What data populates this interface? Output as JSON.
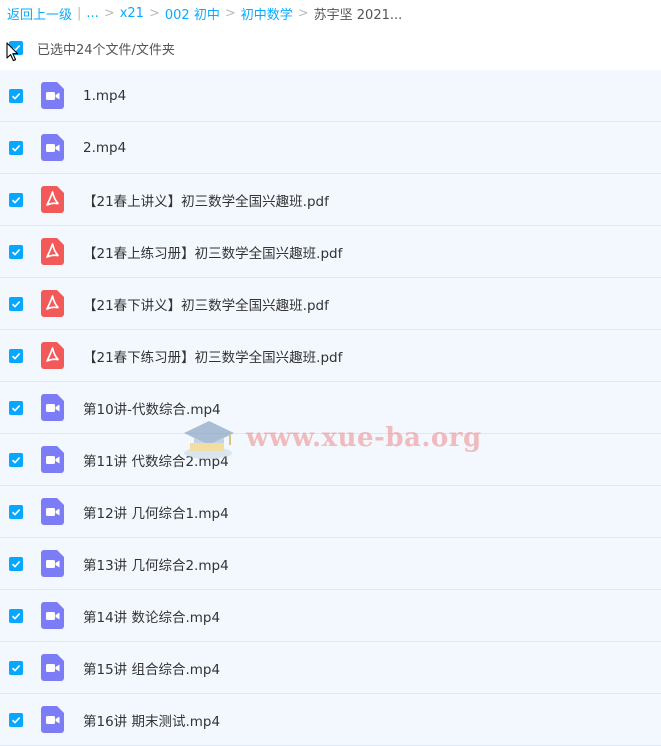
{
  "breadcrumb": {
    "back": "返回上一级",
    "ellipsis": "...",
    "items": [
      "x21",
      "002 初中",
      "初中数学"
    ],
    "current": "苏宇坚 2021..."
  },
  "selection": {
    "text": "已选中24个文件/文件夹"
  },
  "files": [
    {
      "name": "1.mp4",
      "type": "video"
    },
    {
      "name": "2.mp4",
      "type": "video"
    },
    {
      "name": "【21春上讲义】初三数学全国兴趣班.pdf",
      "type": "pdf"
    },
    {
      "name": "【21春上练习册】初三数学全国兴趣班.pdf",
      "type": "pdf"
    },
    {
      "name": "【21春下讲义】初三数学全国兴趣班.pdf",
      "type": "pdf"
    },
    {
      "name": "【21春下练习册】初三数学全国兴趣班.pdf",
      "type": "pdf"
    },
    {
      "name": "第10讲-代数综合.mp4",
      "type": "video"
    },
    {
      "name": "第11讲 代数综合2.mp4",
      "type": "video"
    },
    {
      "name": "第12讲 几何综合1.mp4",
      "type": "video"
    },
    {
      "name": "第13讲 几何综合2.mp4",
      "type": "video"
    },
    {
      "name": "第14讲 数论综合.mp4",
      "type": "video"
    },
    {
      "name": "第15讲 组合综合.mp4",
      "type": "video"
    },
    {
      "name": "第16讲 期末测试.mp4",
      "type": "video"
    }
  ],
  "watermark": {
    "text": "www.xue-ba.org"
  },
  "icons": {
    "video": "video-file-icon",
    "pdf": "pdf-file-icon",
    "checkbox": "checkbox-checked-icon"
  },
  "colors": {
    "accent": "#06a7ff",
    "video_icon": "#7b7cf6",
    "pdf_icon": "#f25a5a",
    "row_bg": "#f2f8fe"
  }
}
